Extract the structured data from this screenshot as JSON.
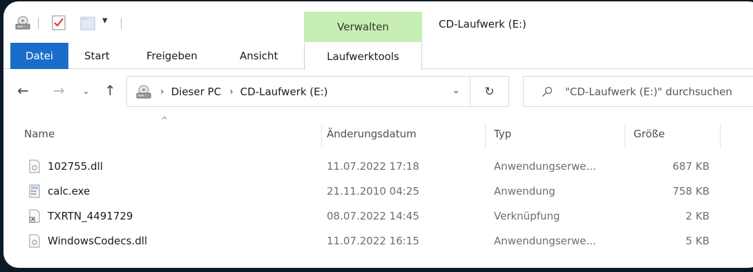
{
  "window": {
    "title": "CD-Laufwerk (E:)",
    "context_tab_group": "Verwalten",
    "qat_dropdown": "▾"
  },
  "ribbon_tabs": {
    "datei": "Datei",
    "start": "Start",
    "freigeben": "Freigeben",
    "ansicht": "Ansicht",
    "laufwerktools": "Laufwerktools"
  },
  "address": {
    "crumbs": [
      "Dieser PC",
      "CD-Laufwerk (E:)"
    ],
    "separator": "›"
  },
  "search": {
    "placeholder": "\"CD-Laufwerk (E:)\" durchsuchen"
  },
  "columns": {
    "name": "Name",
    "date": "Änderungsdatum",
    "type": "Typ",
    "size": "Größe"
  },
  "files": [
    {
      "name": "102755.dll",
      "date": "11.07.2022 17:18",
      "type": "Anwendungserwe...",
      "size": "687 KB",
      "icon": "dll-file-icon"
    },
    {
      "name": "calc.exe",
      "date": "21.11.2010 04:25",
      "type": "Anwendung",
      "size": "758 KB",
      "icon": "exe-file-icon"
    },
    {
      "name": "TXRTN_4491729",
      "date": "08.07.2022 14:45",
      "type": "Verknüpfung",
      "size": "2 KB",
      "icon": "shortcut-file-icon"
    },
    {
      "name": "WindowsCodecs.dll",
      "date": "11.07.2022 16:15",
      "type": "Anwendungserwe...",
      "size": "5 KB",
      "icon": "dll-file-icon"
    }
  ],
  "colors": {
    "accent": "#1a6dc9",
    "context_tab": "#c7eeb3"
  }
}
